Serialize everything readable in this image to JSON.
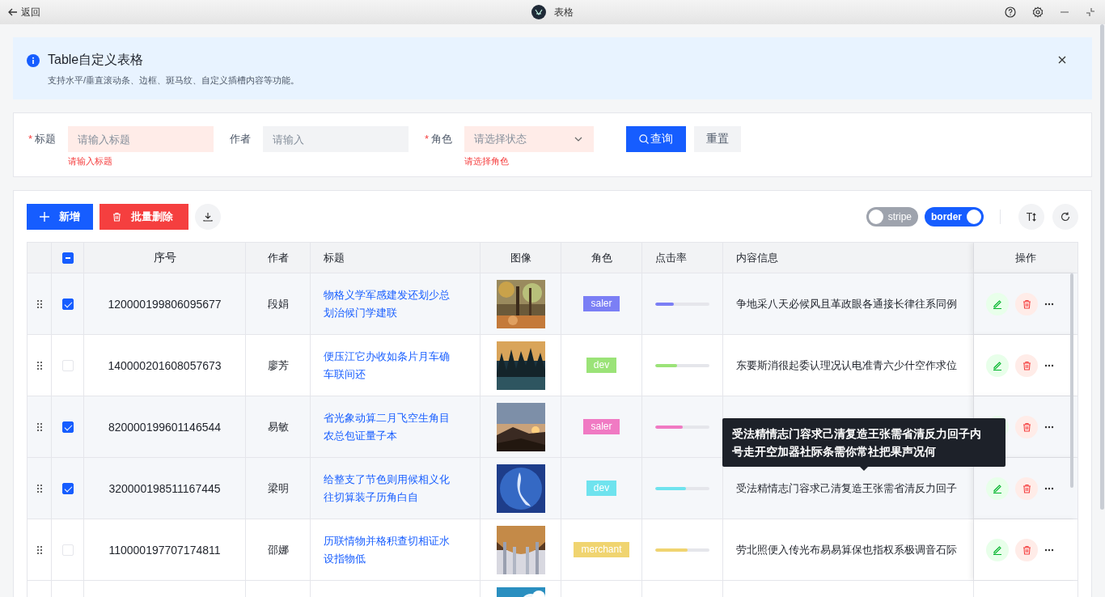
{
  "titlebar": {
    "back": "返回",
    "title": "表格"
  },
  "alert": {
    "title": "Table自定义表格",
    "description": "支持水平/垂直滚动条、边框、斑马纹、自定义插槽内容等功能。"
  },
  "form": {
    "fields": [
      {
        "kind": "input",
        "label": "标题",
        "mark": "*",
        "placeholder": "请输入标题",
        "error": "请输入标题"
      },
      {
        "kind": "input",
        "label": "作者",
        "placeholder": "请输入"
      },
      {
        "kind": "select",
        "label": "角色",
        "mark": "*",
        "placeholder": "请选择状态",
        "error": "请选择角色"
      }
    ],
    "buttons": [
      {
        "kind": "primary",
        "label": "查询"
      },
      {
        "kind": "default",
        "label": "重置"
      }
    ]
  },
  "toolbar": {
    "buttons": [
      {
        "kind": "add",
        "label": "新增"
      },
      {
        "kind": "delete",
        "label": "批量删除"
      },
      {
        "kind": "download"
      }
    ],
    "switches": [
      {
        "label": "stripe",
        "on": false
      },
      {
        "label": "border",
        "on": true
      }
    ],
    "tools": [
      {
        "kind": "font"
      },
      {
        "kind": "refresh"
      }
    ]
  },
  "table": {
    "columns": [
      "序号",
      "作者",
      "标题",
      "图像",
      "角色",
      "点击率",
      "内容信息",
      "操作"
    ],
    "header_checkbox": {
      "indeterminate": true
    },
    "rows": [
      {
        "checked": true,
        "id": "120000199806095677",
        "author": "段娟",
        "title": "物格义学军感建发还划少总划治候门学建联",
        "image": {
          "kind": "picture"
        },
        "role": {
          "label": "saler",
          "color": "#7b7ff5"
        },
        "click_rate": {
          "level": 0.35,
          "color": "#7b7ff5"
        },
        "content": "争地采八天必候风且革政眼各通接长律往系同例"
      },
      {
        "checked": false,
        "id": "140000201608057673",
        "author": "廖芳",
        "title": "便压江它办收如条片月车确车联间还",
        "image": {
          "kind": "picture"
        },
        "role": {
          "label": "dev",
          "color": "#9be378"
        },
        "click_rate": {
          "level": 0.4,
          "color": "#9be378"
        },
        "content": "东要斯消很起委认理况认电准青六少什空作求位"
      },
      {
        "checked": true,
        "id": "820000199601146544",
        "author": "易敏",
        "title": "省光象动算二月飞空生角目农总包证量子本",
        "image": {
          "kind": "picture"
        },
        "role": {
          "label": "saler",
          "color": "#f07ac3"
        },
        "click_rate": {
          "level": 0.5,
          "color": "#f07ac3"
        }
      },
      {
        "checked": true,
        "id": "320000198511167445",
        "author": "梁明",
        "title": "给整支了节色则用候相义化往切算装子历角白自",
        "image": {
          "kind": "picture"
        },
        "role": {
          "label": "dev",
          "color": "#6fe3ee"
        },
        "click_rate": {
          "level": 0.56,
          "color": "#6fe3ee"
        },
        "content": "受法精情志门容求己清复造王张需省清反力回子"
      },
      {
        "checked": false,
        "id": "110000197707174811",
        "author": "邵娜",
        "title": "历联情物并格积查切相证水设指物低",
        "image": {
          "kind": "picture"
        },
        "role": {
          "label": "merchant",
          "color": "#f0d470"
        },
        "click_rate": {
          "level": 0.6,
          "color": "#f0d470"
        },
        "content": "劳北照便入传光布易易算保也指权系极调音石际"
      },
      {
        "image": {
          "kind": "picture"
        }
      }
    ],
    "tooltip": "受法精情志门容求己清复造王张需省清反力回子内号走开空加器社际条需你常社把果声况何"
  }
}
